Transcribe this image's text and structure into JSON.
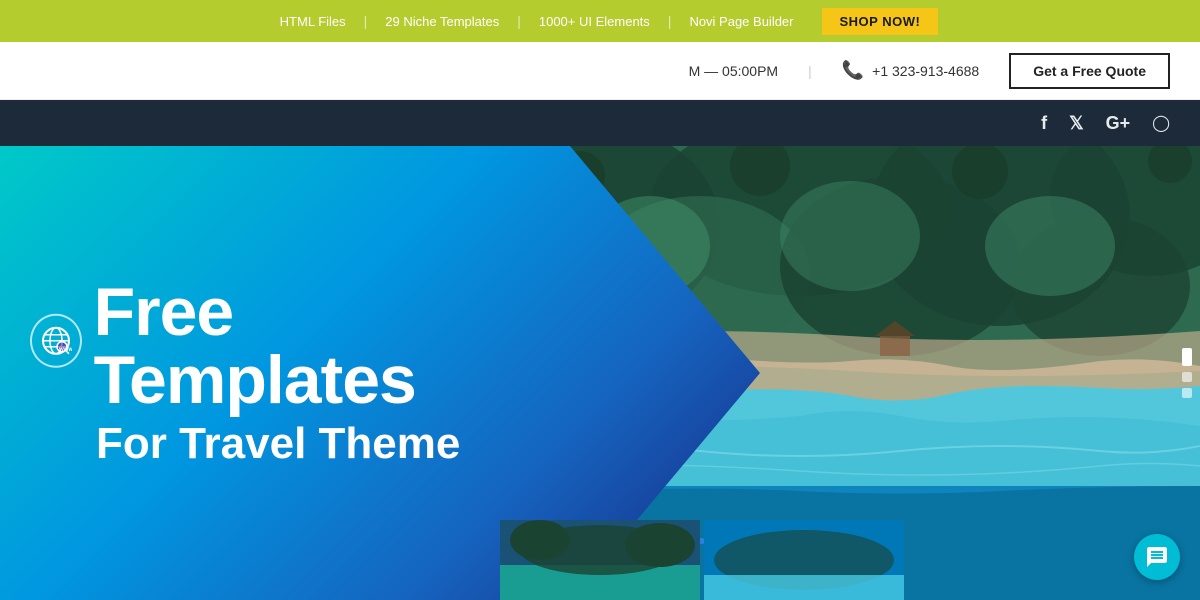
{
  "banner": {
    "items": [
      {
        "label": "HTML Files",
        "id": "html-files"
      },
      {
        "label": "29 Niche Templates",
        "id": "niche-templates"
      },
      {
        "label": "1000+ UI Elements",
        "id": "ui-elements"
      },
      {
        "label": "Novi Page Builder",
        "id": "page-builder"
      }
    ],
    "shop_button": "SHOP NOW!"
  },
  "header": {
    "hours": "M — 05:00PM",
    "phone": "+1 323-913-4688",
    "quote_button": "Get a Free Quote"
  },
  "social": {
    "icons": [
      "facebook",
      "twitter",
      "google-plus",
      "instagram"
    ]
  },
  "hero": {
    "title_free": "Free Templates",
    "title_theme": "For Travel Theme",
    "icon_label": "www"
  },
  "colors": {
    "banner_bg": "#b5cc2e",
    "shop_btn": "#f5c518",
    "header_bg": "#ffffff",
    "social_bg": "#1c2a3a",
    "gradient_start": "#00c9c8",
    "gradient_end": "#1a237e",
    "chat_bubble": "#00bcd4"
  }
}
